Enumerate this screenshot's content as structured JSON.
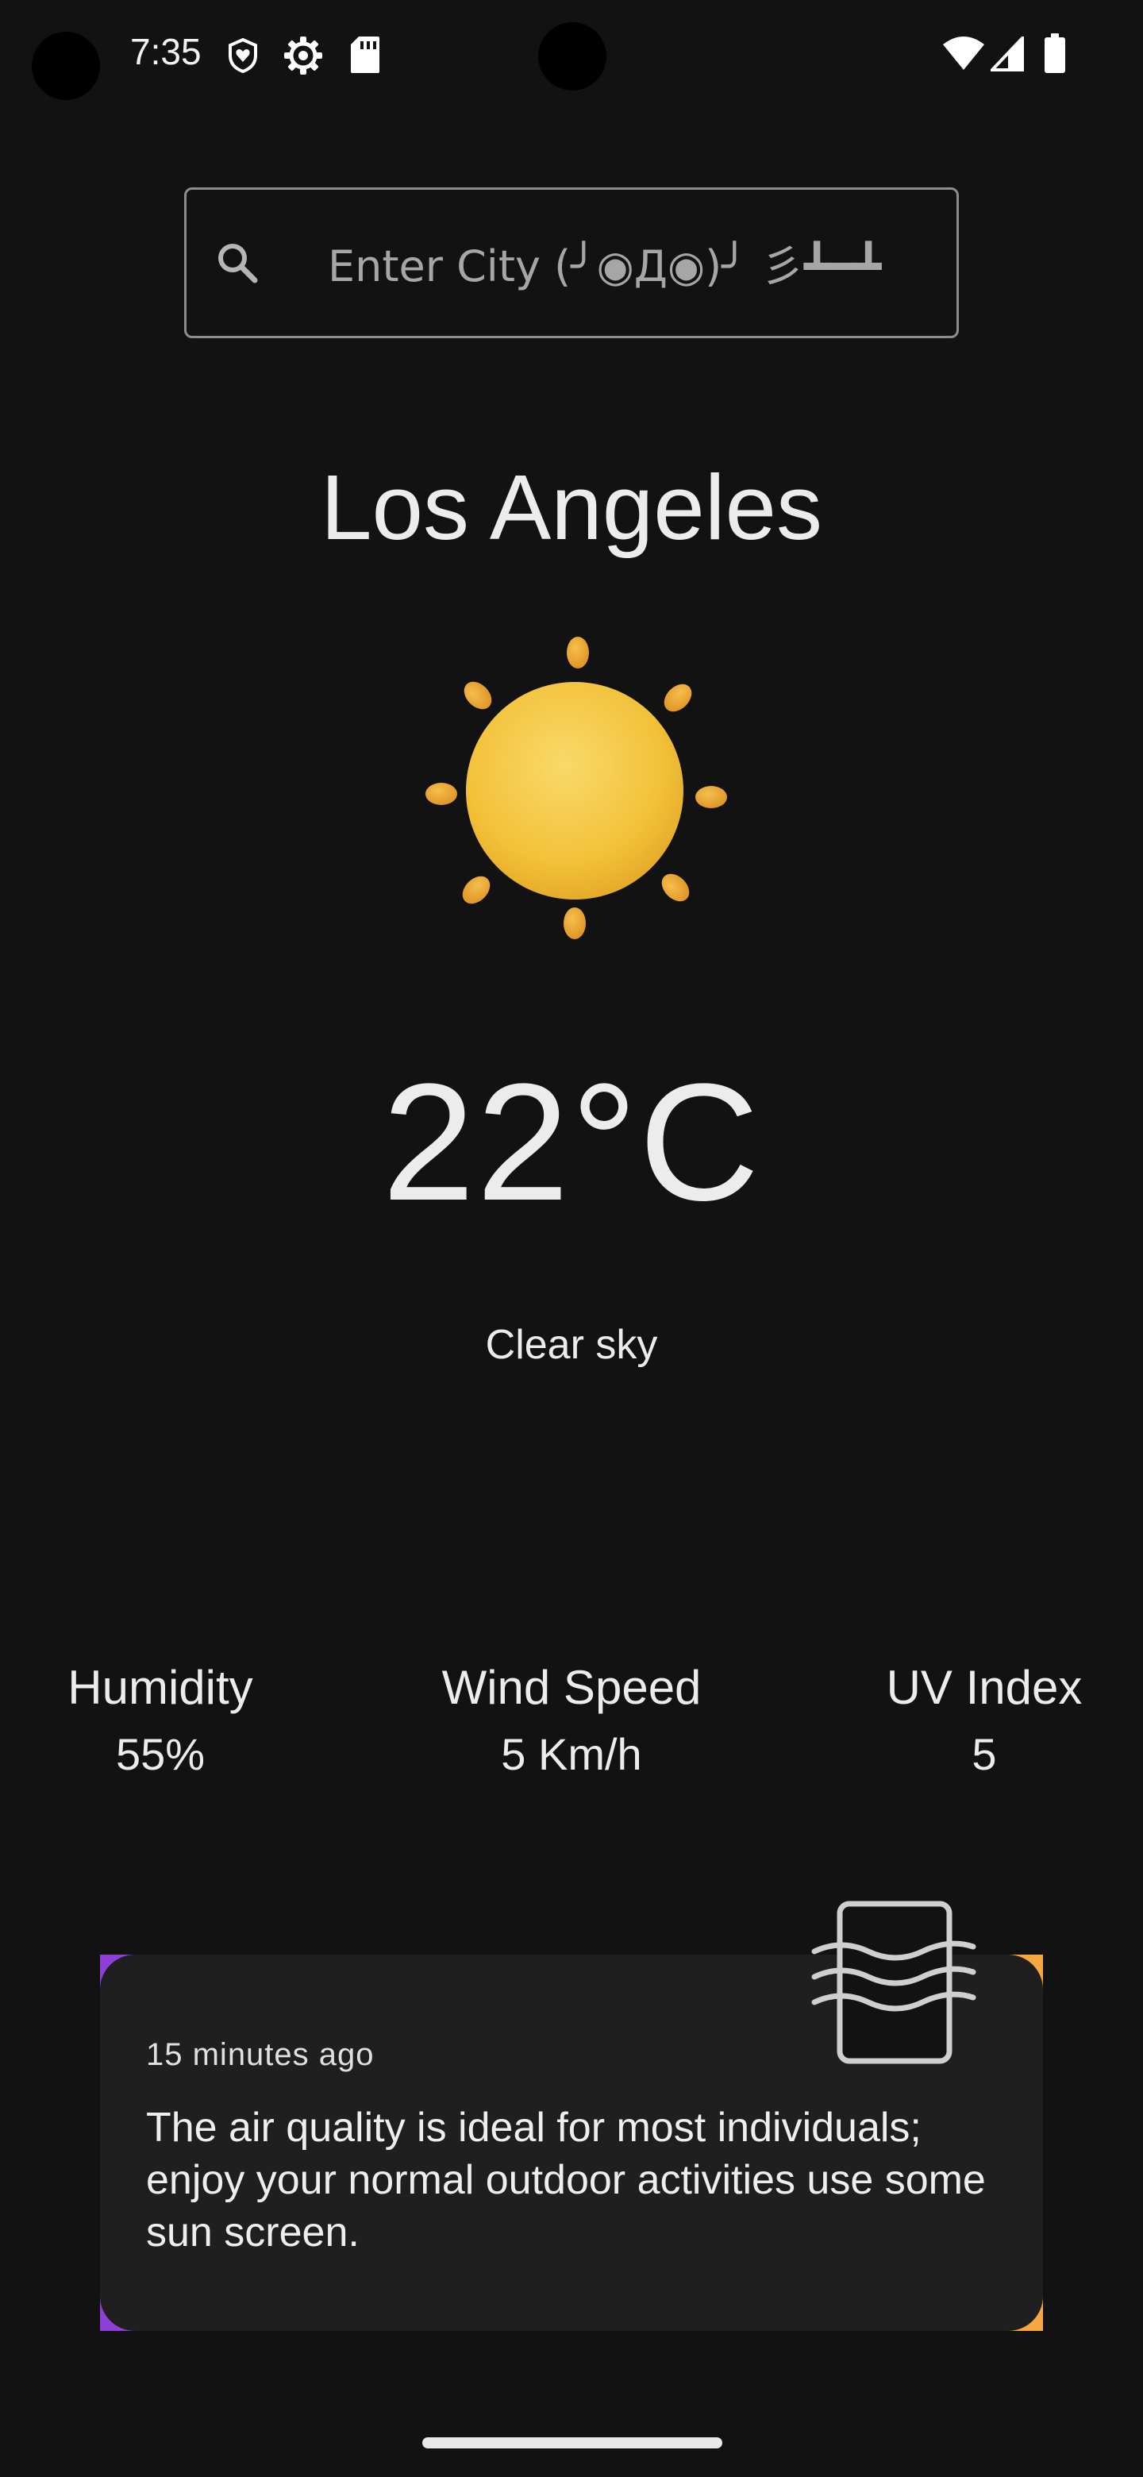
{
  "status_bar": {
    "time": "7:35",
    "icons": [
      "shield-heart-icon",
      "gear-icon",
      "sd-card-icon",
      "wifi-icon",
      "signal-icon",
      "battery-icon"
    ]
  },
  "search": {
    "placeholder": "Enter City (╯◉Д◉)╯ 彡┻━┻",
    "icon": "search-icon"
  },
  "weather": {
    "city": "Los Angeles",
    "icon": "sun-icon",
    "temperature": "22°C",
    "description": "Clear sky"
  },
  "stats": [
    {
      "label": "Humidity",
      "value": "55%"
    },
    {
      "label": "Wind Speed",
      "value": "5 Km/h"
    },
    {
      "label": "UV Index",
      "value": "5"
    }
  ],
  "air_card": {
    "time": "15 minutes ago",
    "message": "The air quality is ideal for most individuals; enjoy your normal outdoor activities use some sun screen.",
    "icon": "air-quality-icon",
    "accent_colors": [
      "#8e3fd6",
      "#f5a742"
    ]
  },
  "colors": {
    "background": "#121212",
    "card": "#1f1f1f",
    "sun": "#f2c138",
    "sun_rays": "#e9a12a"
  }
}
